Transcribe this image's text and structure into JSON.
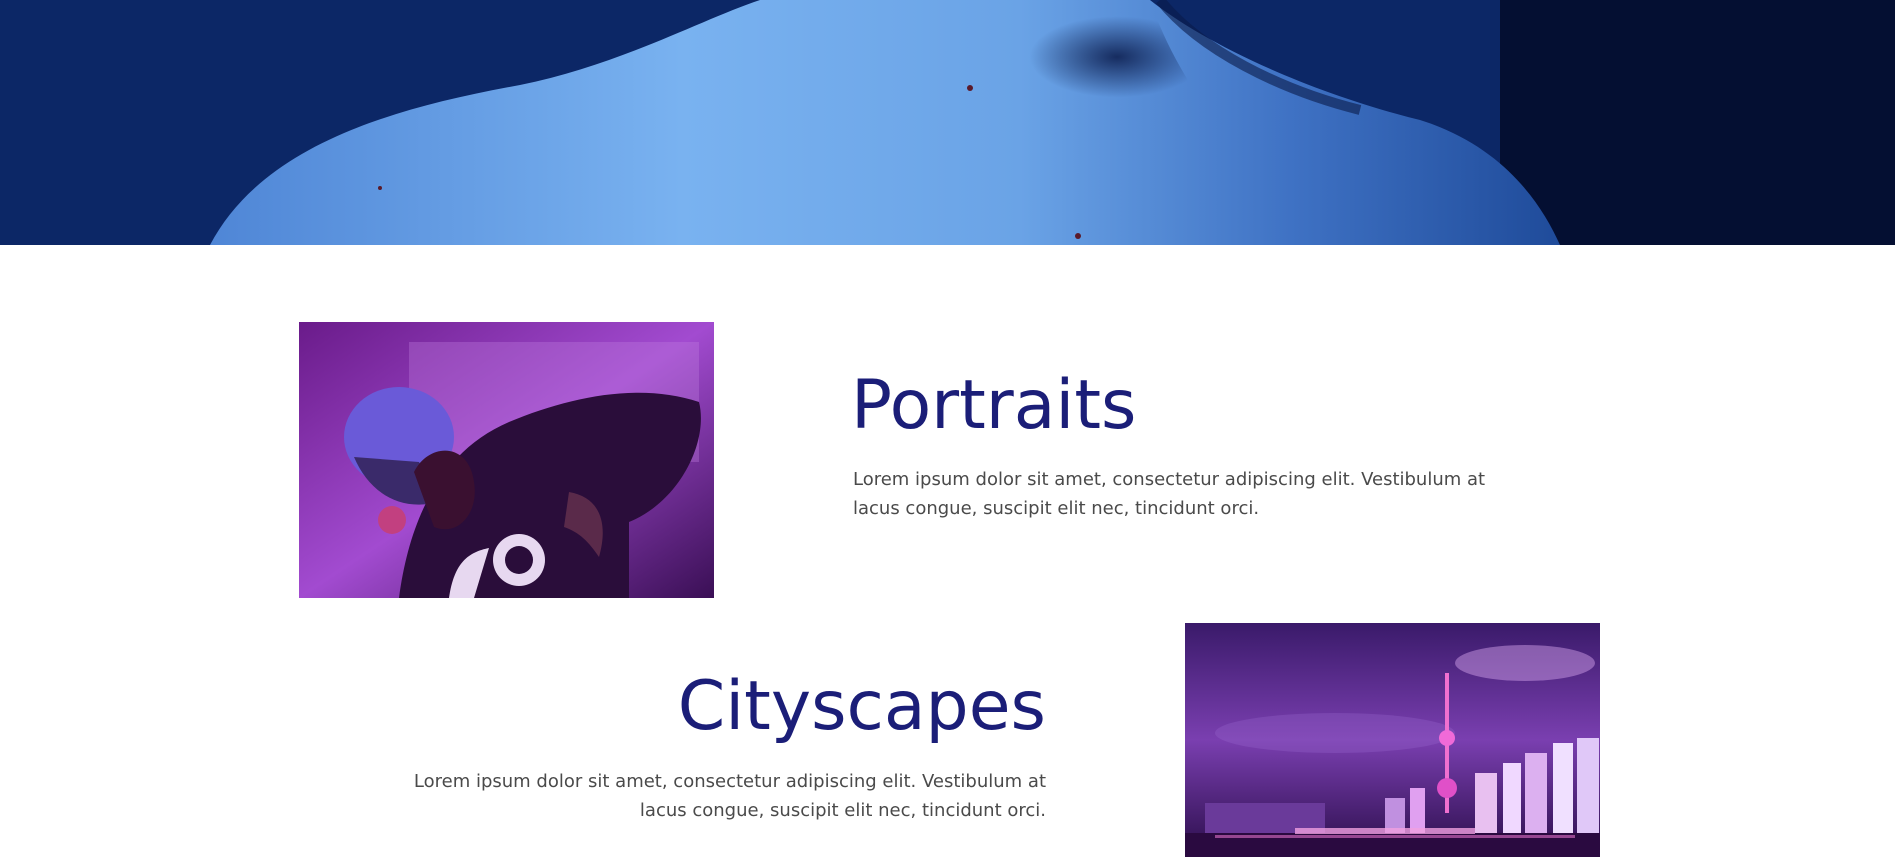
{
  "hero": {
    "image": "shoulders-portrait-blue-photo"
  },
  "sections": [
    {
      "title": "Portraits",
      "body": "Lorem ipsum dolor sit amet, consectetur adipiscing elit. Vestibulum at lacus congue, suscipit elit nec, tincidunt orci.",
      "image": "portrait-man-with-cap-purple-photo"
    },
    {
      "title": "Cityscapes",
      "body": "Lorem ipsum dolor sit amet, consectetur adipiscing elit. Vestibulum at lacus congue, suscipit elit nec, tincidunt orci.",
      "image": "city-skyline-night-purple-photo"
    }
  ],
  "colors": {
    "heading": "#1b1e78",
    "body_text": "#4a4a4a",
    "hero_blue": "#0a2f8a",
    "photo_purple": "#7a1fa0"
  }
}
